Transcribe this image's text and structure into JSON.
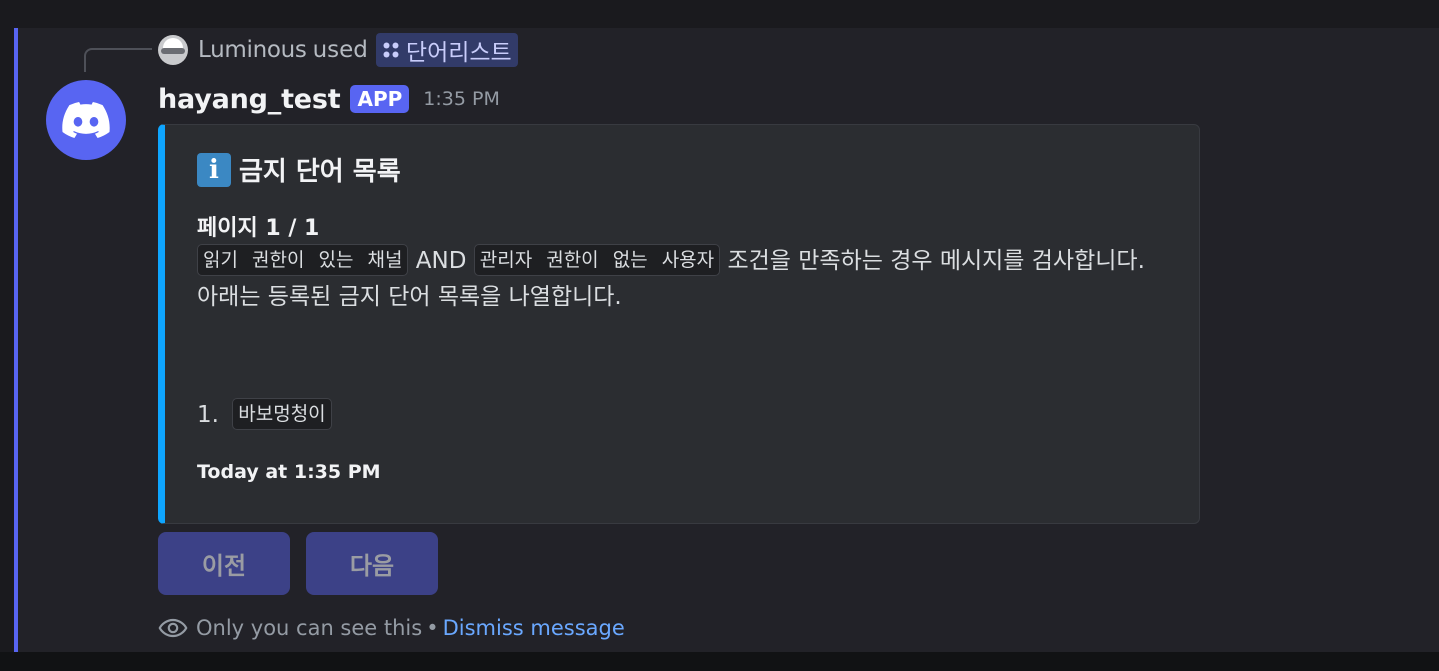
{
  "reply": {
    "username": "Luminous",
    "used_text": "used",
    "command_name": "단어리스트"
  },
  "author": {
    "username": "hayang_test",
    "badge": "APP",
    "timestamp": "1:35 PM"
  },
  "embed": {
    "accent_color": "#0ea5ff",
    "title_icon": "information-icon",
    "title": "금지 단어 목록",
    "page_label": "페이지 1 / 1",
    "condition_chip_1": "읽기 권한이 있는 채널",
    "and_text": "AND",
    "condition_chip_2": "관리자 권한이 없는 사용자",
    "desc_line1_tail": "조건을 만족하는 경우 메시지를 검사합니다.",
    "desc_line2": "아래는 등록된 금지 단어 목록을 나열합니다.",
    "list": [
      {
        "number": "1.",
        "word": "바보멍청이"
      }
    ],
    "footer": "Today at 1:35 PM"
  },
  "buttons": {
    "prev": "이전",
    "next": "다음"
  },
  "ephemeral": {
    "notice": "Only you can see this",
    "separator": "•",
    "dismiss": "Dismiss message"
  },
  "colors": {
    "brand": "#5865f2",
    "link": "#6aa8ff",
    "button_bg": "#3c4187"
  }
}
